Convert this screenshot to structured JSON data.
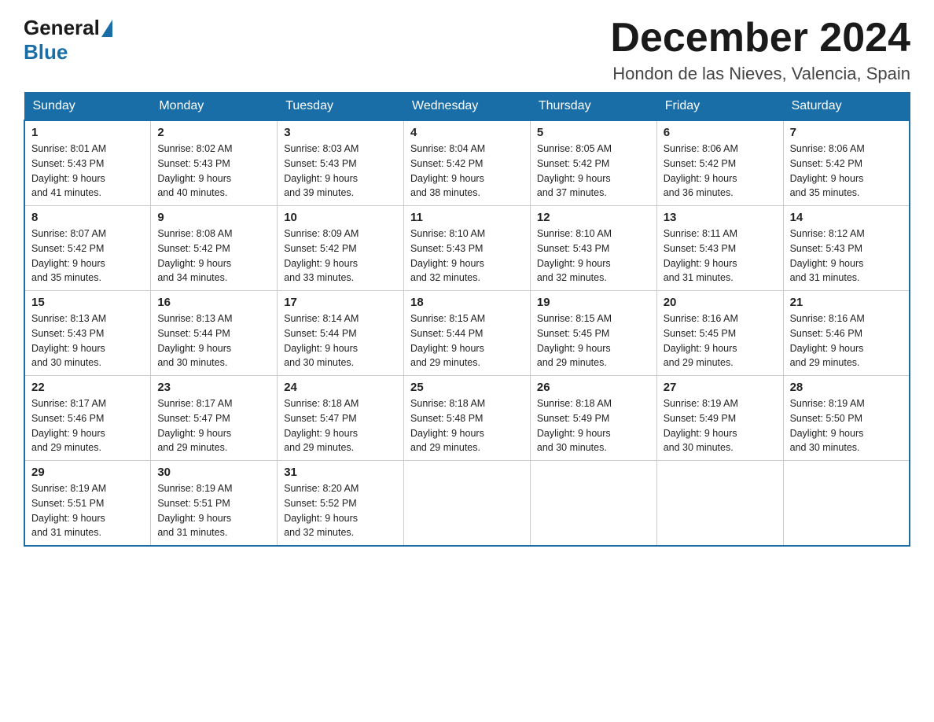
{
  "logo": {
    "general": "General",
    "blue": "Blue"
  },
  "title": "December 2024",
  "location": "Hondon de las Nieves, Valencia, Spain",
  "weekdays": [
    "Sunday",
    "Monday",
    "Tuesday",
    "Wednesday",
    "Thursday",
    "Friday",
    "Saturday"
  ],
  "weeks": [
    [
      {
        "day": "1",
        "sunrise": "8:01 AM",
        "sunset": "5:43 PM",
        "daylight": "9 hours and 41 minutes."
      },
      {
        "day": "2",
        "sunrise": "8:02 AM",
        "sunset": "5:43 PM",
        "daylight": "9 hours and 40 minutes."
      },
      {
        "day": "3",
        "sunrise": "8:03 AM",
        "sunset": "5:43 PM",
        "daylight": "9 hours and 39 minutes."
      },
      {
        "day": "4",
        "sunrise": "8:04 AM",
        "sunset": "5:42 PM",
        "daylight": "9 hours and 38 minutes."
      },
      {
        "day": "5",
        "sunrise": "8:05 AM",
        "sunset": "5:42 PM",
        "daylight": "9 hours and 37 minutes."
      },
      {
        "day": "6",
        "sunrise": "8:06 AM",
        "sunset": "5:42 PM",
        "daylight": "9 hours and 36 minutes."
      },
      {
        "day": "7",
        "sunrise": "8:06 AM",
        "sunset": "5:42 PM",
        "daylight": "9 hours and 35 minutes."
      }
    ],
    [
      {
        "day": "8",
        "sunrise": "8:07 AM",
        "sunset": "5:42 PM",
        "daylight": "9 hours and 35 minutes."
      },
      {
        "day": "9",
        "sunrise": "8:08 AM",
        "sunset": "5:42 PM",
        "daylight": "9 hours and 34 minutes."
      },
      {
        "day": "10",
        "sunrise": "8:09 AM",
        "sunset": "5:42 PM",
        "daylight": "9 hours and 33 minutes."
      },
      {
        "day": "11",
        "sunrise": "8:10 AM",
        "sunset": "5:43 PM",
        "daylight": "9 hours and 32 minutes."
      },
      {
        "day": "12",
        "sunrise": "8:10 AM",
        "sunset": "5:43 PM",
        "daylight": "9 hours and 32 minutes."
      },
      {
        "day": "13",
        "sunrise": "8:11 AM",
        "sunset": "5:43 PM",
        "daylight": "9 hours and 31 minutes."
      },
      {
        "day": "14",
        "sunrise": "8:12 AM",
        "sunset": "5:43 PM",
        "daylight": "9 hours and 31 minutes."
      }
    ],
    [
      {
        "day": "15",
        "sunrise": "8:13 AM",
        "sunset": "5:43 PM",
        "daylight": "9 hours and 30 minutes."
      },
      {
        "day": "16",
        "sunrise": "8:13 AM",
        "sunset": "5:44 PM",
        "daylight": "9 hours and 30 minutes."
      },
      {
        "day": "17",
        "sunrise": "8:14 AM",
        "sunset": "5:44 PM",
        "daylight": "9 hours and 30 minutes."
      },
      {
        "day": "18",
        "sunrise": "8:15 AM",
        "sunset": "5:44 PM",
        "daylight": "9 hours and 29 minutes."
      },
      {
        "day": "19",
        "sunrise": "8:15 AM",
        "sunset": "5:45 PM",
        "daylight": "9 hours and 29 minutes."
      },
      {
        "day": "20",
        "sunrise": "8:16 AM",
        "sunset": "5:45 PM",
        "daylight": "9 hours and 29 minutes."
      },
      {
        "day": "21",
        "sunrise": "8:16 AM",
        "sunset": "5:46 PM",
        "daylight": "9 hours and 29 minutes."
      }
    ],
    [
      {
        "day": "22",
        "sunrise": "8:17 AM",
        "sunset": "5:46 PM",
        "daylight": "9 hours and 29 minutes."
      },
      {
        "day": "23",
        "sunrise": "8:17 AM",
        "sunset": "5:47 PM",
        "daylight": "9 hours and 29 minutes."
      },
      {
        "day": "24",
        "sunrise": "8:18 AM",
        "sunset": "5:47 PM",
        "daylight": "9 hours and 29 minutes."
      },
      {
        "day": "25",
        "sunrise": "8:18 AM",
        "sunset": "5:48 PM",
        "daylight": "9 hours and 29 minutes."
      },
      {
        "day": "26",
        "sunrise": "8:18 AM",
        "sunset": "5:49 PM",
        "daylight": "9 hours and 30 minutes."
      },
      {
        "day": "27",
        "sunrise": "8:19 AM",
        "sunset": "5:49 PM",
        "daylight": "9 hours and 30 minutes."
      },
      {
        "day": "28",
        "sunrise": "8:19 AM",
        "sunset": "5:50 PM",
        "daylight": "9 hours and 30 minutes."
      }
    ],
    [
      {
        "day": "29",
        "sunrise": "8:19 AM",
        "sunset": "5:51 PM",
        "daylight": "9 hours and 31 minutes."
      },
      {
        "day": "30",
        "sunrise": "8:19 AM",
        "sunset": "5:51 PM",
        "daylight": "9 hours and 31 minutes."
      },
      {
        "day": "31",
        "sunrise": "8:20 AM",
        "sunset": "5:52 PM",
        "daylight": "9 hours and 32 minutes."
      },
      null,
      null,
      null,
      null
    ]
  ],
  "labels": {
    "sunrise": "Sunrise:",
    "sunset": "Sunset:",
    "daylight": "Daylight:"
  }
}
